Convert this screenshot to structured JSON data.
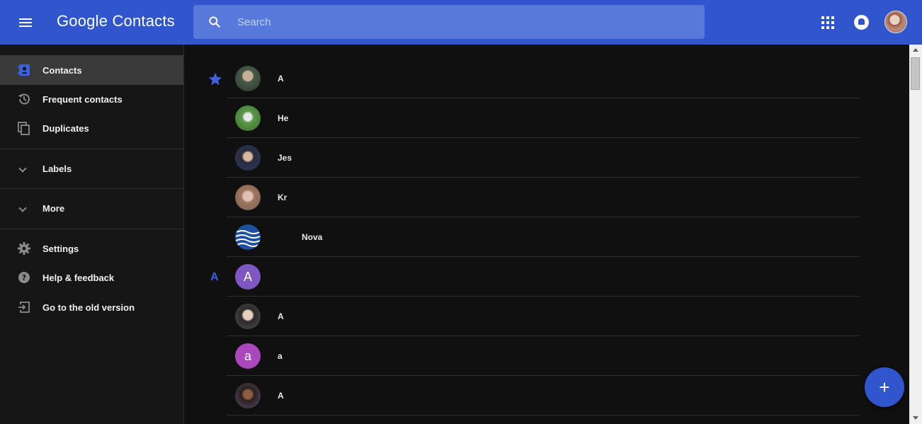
{
  "header": {
    "app_title": "Google Contacts",
    "search_placeholder": "Search"
  },
  "sidebar": {
    "items": [
      {
        "label": "Contacts",
        "icon": "contacts-icon",
        "active": true
      },
      {
        "label": "Frequent contacts",
        "icon": "history-icon"
      },
      {
        "label": "Duplicates",
        "icon": "duplicates-icon"
      }
    ],
    "labels_section": "Labels",
    "more_section": "More",
    "footer_items": [
      {
        "label": "Settings",
        "icon": "gear-icon"
      },
      {
        "label": "Help & feedback",
        "icon": "help-icon"
      },
      {
        "label": "Go to the old version",
        "icon": "exit-icon"
      }
    ]
  },
  "contacts": {
    "section_letter": "A",
    "rows": [
      {
        "name": "A",
        "avatar_color": "#5a6a5a"
      },
      {
        "name": "He",
        "avatar_color": "#4a7a4a"
      },
      {
        "name": "Jes",
        "avatar_color": "#3a4a7a"
      },
      {
        "name": "Kr",
        "avatar_color": "#8a7060"
      },
      {
        "name": "Nova",
        "avatar_color": "#1f4fa0"
      },
      {
        "name": "",
        "letter": "A",
        "avatar_color": "#7e57c2"
      },
      {
        "name": "A",
        "avatar_color": "#6a6a6a"
      },
      {
        "name": "a",
        "letter": "a",
        "avatar_color": "#ab47bc"
      },
      {
        "name": "A",
        "avatar_color": "#5a4a6a"
      }
    ]
  },
  "colors": {
    "accent": "#3055cc",
    "background": "#101010",
    "sidebar": "#161616"
  }
}
